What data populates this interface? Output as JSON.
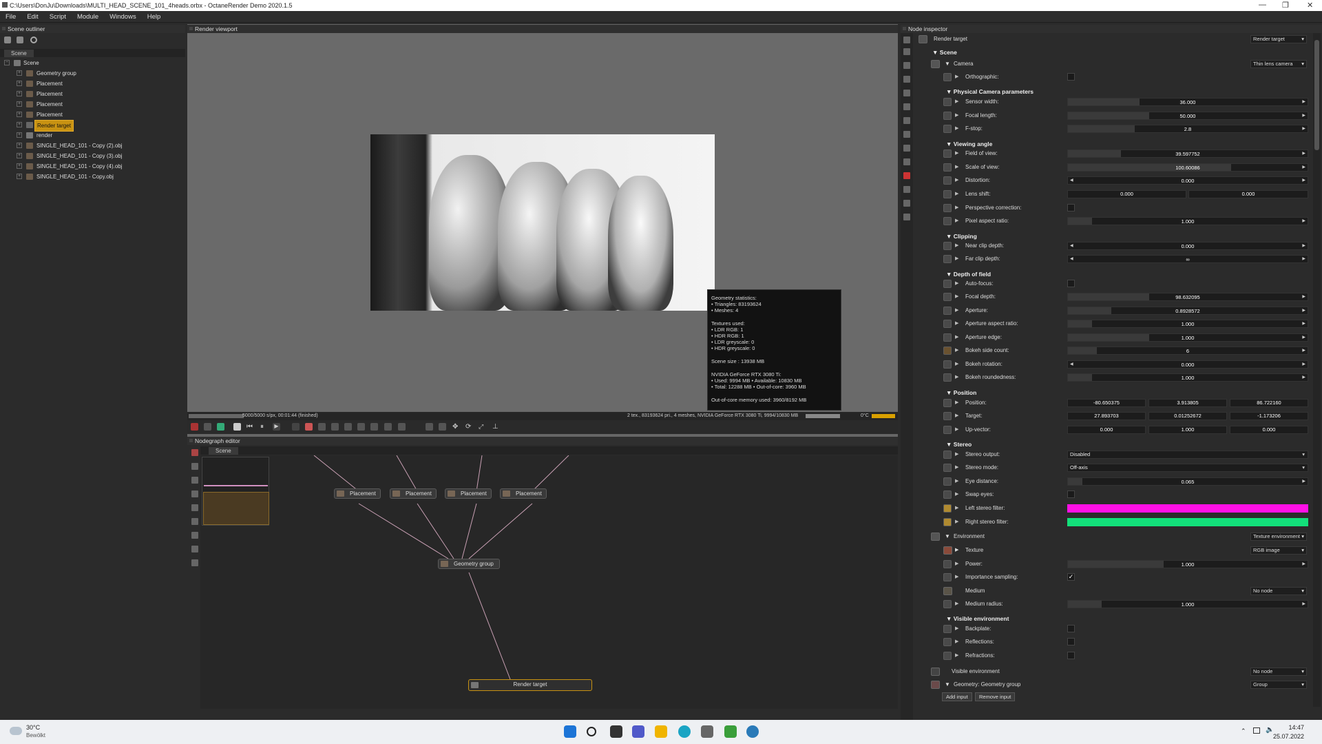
{
  "window": {
    "title": "C:\\Users\\DonJu\\Downloads\\MULTI_HEAD_SCENE_101_4heads.orbx - OctaneRender Demo 2020.1.5"
  },
  "menu": [
    "File",
    "Edit",
    "Script",
    "Module",
    "Windows",
    "Help"
  ],
  "outliner": {
    "title": "Scene outliner",
    "tab": "Scene",
    "root": "Scene",
    "items": [
      "Geometry group",
      "Placement",
      "Placement",
      "Placement",
      "Placement",
      "Render target",
      "render",
      "SINGLE_HEAD_101 - Copy (2).obj",
      "SINGLE_HEAD_101 - Copy (3).obj",
      "SINGLE_HEAD_101 - Copy (4).obj",
      "SINGLE_HEAD_101 - Copy.obj"
    ],
    "selected": "Render target"
  },
  "viewport": {
    "title": "Render viewport",
    "progress": "5000/5000 s/px, 00:01:44 (finished)",
    "status": "2 tex., 83193624 pri., 4 meshes, NVIDIA GeForce RTX 3080 Ti, 9994/10830 MB",
    "temp": "0°C"
  },
  "stats": {
    "geo_title": "Geometry statistics:",
    "triangles": "• Triangles: 83193624",
    "meshes": "• Meshes: 4",
    "tex_title": "Textures used:",
    "ldr_rgb": "• LDR RGB: 1",
    "hdr_rgb": "• HDR RGB: 1",
    "ldr_grey": "• LDR greyscale: 0",
    "hdr_grey": "• HDR greyscale: 0",
    "scene_size": "Scene size : 13938 MB",
    "gpu": "NVIDIA GeForce RTX 3080 Ti:",
    "gpu_used": "• Used: 9994 MB • Available: 10830 MB",
    "gpu_total": "• Total: 12288 MB • Out-of-core: 3960 MB",
    "ooc": "Out-of-core memory used: 3960/8192 MB"
  },
  "nodegraph": {
    "title": "Nodegraph editor",
    "tab": "Scene",
    "nodes": {
      "p1": "Placement",
      "p2": "Placement",
      "p3": "Placement",
      "p4": "Placement",
      "geo": "Geometry group",
      "rt": "Render target"
    }
  },
  "inspector": {
    "title": "Node inspector",
    "header": "Render target",
    "header_dd": "Render target",
    "scene": "Scene",
    "camera": "Camera",
    "camera_dd": "Thin lens camera",
    "orthographic": "Orthographic:",
    "phys": "Physical Camera parameters",
    "sensor_width": {
      "label": "Sensor width:",
      "value": "36.000"
    },
    "focal_length": {
      "label": "Focal length:",
      "value": "50.000"
    },
    "fstop": {
      "label": "F-stop:",
      "value": "2.8"
    },
    "viewing": "Viewing angle",
    "fov": {
      "label": "Field of view:",
      "value": "39.597752"
    },
    "scale": {
      "label": "Scale of view:",
      "value": "100.60086"
    },
    "distortion": {
      "label": "Distortion:",
      "value": "0.000"
    },
    "lens_shift": {
      "label": "Lens shift:",
      "x": "0.000",
      "y": "0.000"
    },
    "persp": "Perspective correction:",
    "pixel_aspect": {
      "label": "Pixel aspect ratio:",
      "value": "1.000"
    },
    "clipping": "Clipping",
    "near": {
      "label": "Near clip depth:",
      "value": "0.000"
    },
    "far": {
      "label": "Far clip depth:",
      "value": "∞"
    },
    "dof": "Depth of field",
    "autofocus": "Auto-focus:",
    "focal_depth": {
      "label": "Focal depth:",
      "value": "98.632095"
    },
    "aperture": {
      "label": "Aperture:",
      "value": "0.8928572"
    },
    "aperture_ratio": {
      "label": "Aperture aspect ratio:",
      "value": "1.000"
    },
    "aperture_edge": {
      "label": "Aperture edge:",
      "value": "1.000"
    },
    "bokeh_side": {
      "label": "Bokeh side count:",
      "value": "6"
    },
    "bokeh_rot": {
      "label": "Bokeh rotation:",
      "value": "0.000"
    },
    "bokeh_round": {
      "label": "Bokeh roundedness:",
      "value": "1.000"
    },
    "position_sect": "Position",
    "position": {
      "label": "Position:",
      "x": "-80.650375",
      "y": "3.913805",
      "z": "86.722160"
    },
    "target": {
      "label": "Target:",
      "x": "27.893703",
      "y": "0.01252672",
      "z": "-1.173206"
    },
    "up": {
      "label": "Up-vector:",
      "x": "0.000",
      "y": "1.000",
      "z": "0.000"
    },
    "stereo": "Stereo",
    "stereo_output": {
      "label": "Stereo output:",
      "value": "Disabled"
    },
    "stereo_mode": {
      "label": "Stereo mode:",
      "value": "Off-axis"
    },
    "eye_distance": {
      "label": "Eye distance:",
      "value": "0.065"
    },
    "swap_eyes": "Swap eyes:",
    "left_filter": {
      "label": "Left stereo filter:",
      "color": "#ff10e6"
    },
    "right_filter": {
      "label": "Right stereo filter:",
      "color": "#13e07a"
    },
    "environment": "Environment",
    "env_dd": "Texture environment",
    "texture": "Texture",
    "texture_dd": "RGB image",
    "power": {
      "label": "Power:",
      "value": "1.000"
    },
    "importance": "Importance sampling:",
    "medium": "Medium",
    "medium_dd": "No node",
    "medium_radius": {
      "label": "Medium radius:",
      "value": "1.000"
    },
    "visible_env": "Visible environment",
    "backplate": "Backplate:",
    "reflections": "Reflections:",
    "refractions": "Refractions:",
    "visible_env_node": "Visible environment",
    "visible_env_dd": "No node",
    "geometry": "Geometry: Geometry group",
    "geometry_dd": "Group",
    "add_input": "Add input",
    "remove_input": "Remove input"
  },
  "taskbar": {
    "temp": "30°C",
    "weather": "Bewölkt",
    "time": "14:47",
    "date": "25.07.2022"
  }
}
